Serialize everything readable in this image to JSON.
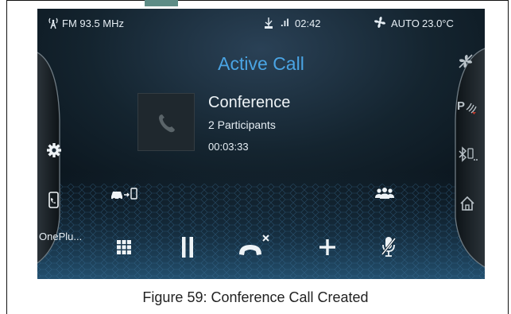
{
  "status_bar": {
    "radio": "FM 93.5 MHz",
    "signal": ".ıl",
    "time": "02:42",
    "climate_mode": "AUTO",
    "temperature": "23.0°C"
  },
  "call": {
    "title": "Active Call",
    "caller_name": "Conference",
    "participants": "2 Participants",
    "duration": "00:03:33"
  },
  "left_panel": {
    "device_label": "OnePlu..."
  },
  "icons": {
    "radio": "radio-antenna-icon",
    "usb": "usb-icon",
    "fan": "fan-icon",
    "settings": "settings-gear-icon",
    "phone": "phone-device-icon",
    "car_to_phone": "car-to-phone-icon",
    "participants": "participants-icon",
    "climate_off": "climate-off-icon",
    "parking_sensor": "parking-sensor-icon",
    "bluetooth": "bluetooth-icon",
    "home": "home-icon",
    "keypad": "keypad-icon",
    "hold": "hold-icon",
    "end_call": "end-call-icon",
    "add_call": "add-call-icon",
    "mute": "mute-mic-icon"
  },
  "caption": "Figure 59: Conference Call Created"
}
